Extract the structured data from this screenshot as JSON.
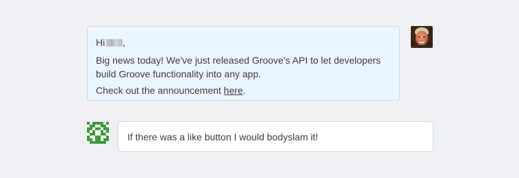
{
  "conversation": {
    "agent_message": {
      "greeting": "Hi",
      "greeting_suffix": ",",
      "body": "Big news today! We've just released Groove's API to let developers build Groove functionality into any app.",
      "cta_prefix": "Check out the announcement ",
      "cta_link": "here",
      "cta_suffix": "."
    },
    "customer_message": {
      "text": "If there was a like button I would bodyslam it!"
    }
  },
  "colors": {
    "background": "#eef0f4",
    "agent_bubble": "#ebf5fd",
    "customer_bubble": "#ffffff",
    "identicon_green": "#3e9a3e"
  },
  "icons": {
    "agent_avatar": "user-photo-avatar",
    "customer_avatar": "identicon-avatar"
  }
}
